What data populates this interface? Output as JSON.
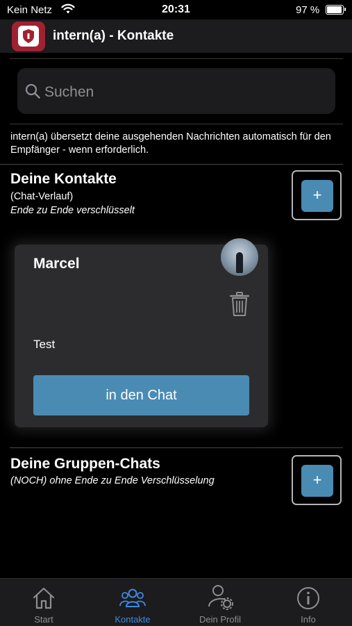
{
  "status_bar": {
    "carrier": "Kein Netz",
    "time": "20:31",
    "battery": "97 %"
  },
  "header": {
    "title": "intern(a) - Kontakte"
  },
  "search": {
    "placeholder": "Suchen"
  },
  "info_text": "intern(a) übersetzt deine ausgehenden Nachrichten automatisch für den Empfänger - wenn erforderlich.",
  "contacts_section": {
    "title": "Deine Kontakte",
    "subtitle": "(Chat-Verlauf)",
    "note": "Ende zu Ende verschlüsselt",
    "add_label": "+"
  },
  "contact_card": {
    "name": "Marcel",
    "message": "Test",
    "chat_button": "in den Chat"
  },
  "groups_section": {
    "title": "Deine Gruppen-Chats",
    "note": "(NOCH) ohne Ende zu Ende Verschlüsselung",
    "add_label": "+"
  },
  "tabs": [
    {
      "label": "Start",
      "icon": "home-icon",
      "active": false
    },
    {
      "label": "Kontakte",
      "icon": "people-icon",
      "active": true
    },
    {
      "label": "Dein Profil",
      "icon": "profile-settings-icon",
      "active": false
    },
    {
      "label": "Info",
      "icon": "info-icon",
      "active": false
    }
  ],
  "colors": {
    "accent": "#4a8bb4",
    "active_tab": "#3c8ae6",
    "logo": "#a02230"
  }
}
